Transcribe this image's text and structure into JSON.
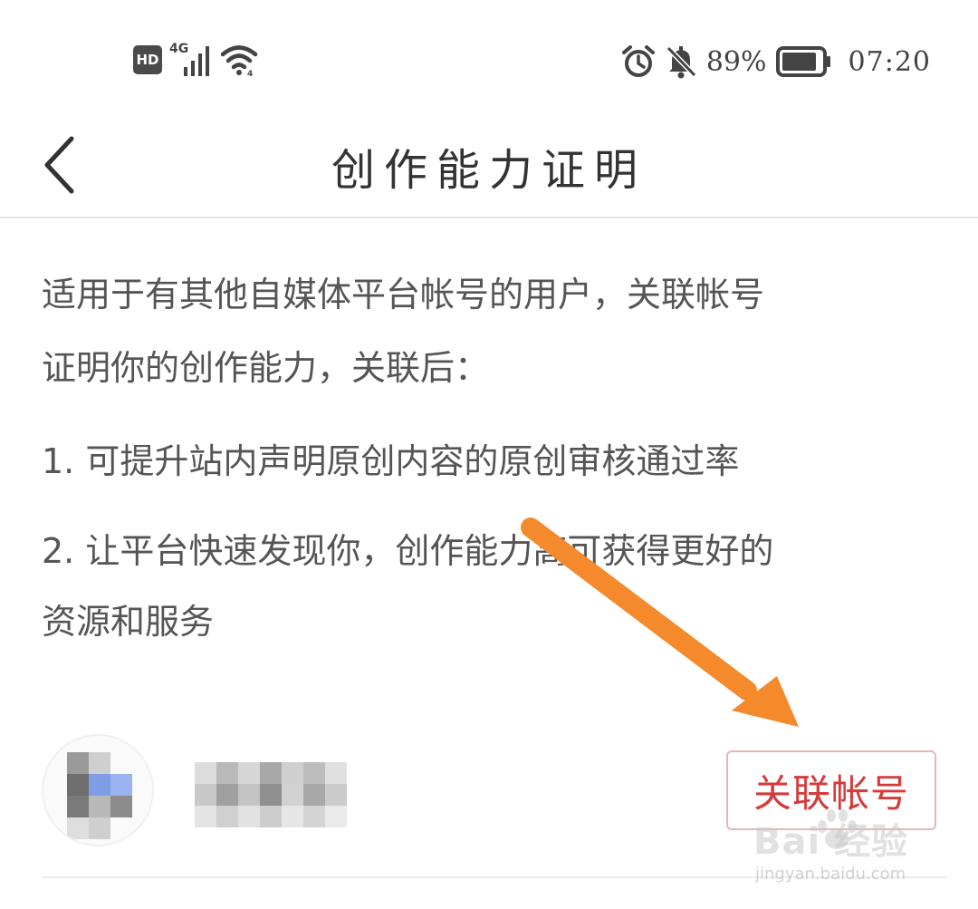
{
  "status_bar": {
    "hd_label": "HD",
    "network_label": "4G",
    "battery_percent": "89%",
    "battery_level": 0.89,
    "time": "07:20",
    "icons": [
      "hd-icon",
      "signal-icon",
      "wifi-icon",
      "alarm-icon",
      "bell-muted-icon",
      "battery-icon"
    ]
  },
  "nav": {
    "back_icon": "chevron-left-icon",
    "title": "创作能力证明"
  },
  "content": {
    "description_lines": [
      "适用于有其他自媒体平台帐号的用户，关联帐号",
      "证明你的创作能力，关联后："
    ],
    "items": [
      "1. 可提升站内声明原创内容的原创审核通过率",
      "2. 让平台快速发现你，创作能力高可获得更好的",
      "资源和服务"
    ]
  },
  "account_row": {
    "link_button_label": "关联帐号"
  },
  "colors": {
    "accent_red": "#d63a3a",
    "annotation_orange": "#f58a2c",
    "text_gray": "#555555"
  },
  "watermark": {
    "main": "Bai  经验",
    "sub": "jingyan.baidu.com"
  }
}
